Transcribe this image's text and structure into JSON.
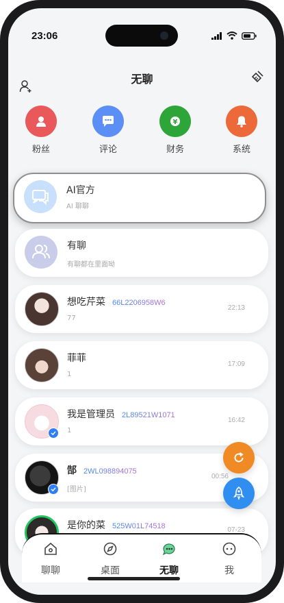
{
  "status": {
    "time": "23:06"
  },
  "header": {
    "title": "无聊"
  },
  "categories": [
    {
      "label": "粉丝",
      "color": "#e9585a",
      "icon": "user-icon"
    },
    {
      "label": "评论",
      "color": "#5b8ff5",
      "icon": "comment-icon"
    },
    {
      "label": "财务",
      "color": "#2ea538",
      "icon": "yen-icon"
    },
    {
      "label": "系统",
      "color": "#ec6a3a",
      "icon": "bell-icon"
    }
  ],
  "chats": [
    {
      "name": "AI官方",
      "sub": "AI 聊聊",
      "uid": "",
      "time": ""
    },
    {
      "name": "有聊",
      "sub": "有聊都在里面呦",
      "uid": "",
      "time": ""
    },
    {
      "name": "想吃芹菜",
      "sub": "77",
      "uid": "66L2206958W6",
      "time": "22:13"
    },
    {
      "name": "菲菲",
      "sub": "1",
      "uid": "",
      "time": "17:09"
    },
    {
      "name": "我是管理员",
      "sub": "1",
      "uid": "2L89521W1071",
      "time": "16:42"
    },
    {
      "name": "郜",
      "sub": "[图片]",
      "uid": "2WL098894075",
      "time": "00:56"
    },
    {
      "name": "是你的菜",
      "sub": "",
      "uid": "525W01L74518",
      "time": "07-23"
    }
  ],
  "tabs": [
    {
      "label": "聊聊"
    },
    {
      "label": "桌面"
    },
    {
      "label": "无聊"
    },
    {
      "label": "我"
    }
  ],
  "colors": {
    "accent_blue": "#2e7ef5",
    "fab_orange": "#f08a24",
    "fab_blue": "#2f8ef0"
  }
}
